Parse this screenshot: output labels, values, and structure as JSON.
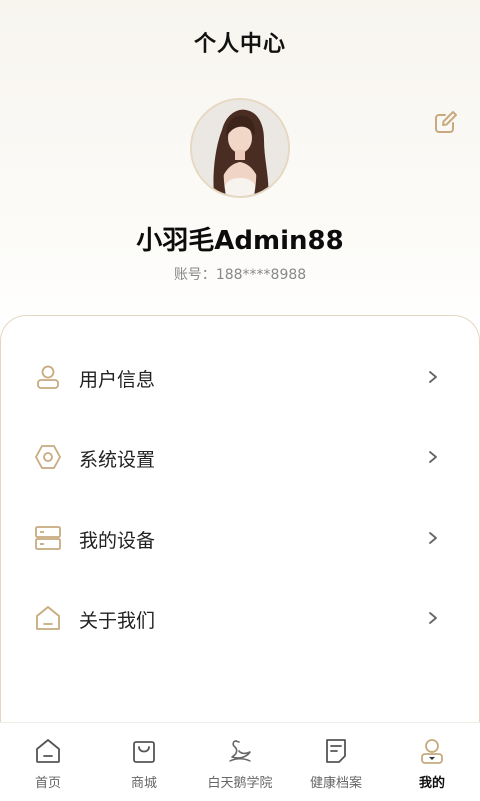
{
  "header": {
    "title": "个人中心"
  },
  "profile": {
    "username": "小羽毛Admin88",
    "account_label": "账号：",
    "account_value": "188****8988"
  },
  "menu": [
    {
      "label": "用户信息",
      "icon": "user-icon"
    },
    {
      "label": "系统设置",
      "icon": "settings-hexagon-icon"
    },
    {
      "label": "我的设备",
      "icon": "device-icon"
    },
    {
      "label": "关于我们",
      "icon": "house-icon"
    }
  ],
  "tabs": [
    {
      "label": "首页",
      "icon": "home-icon"
    },
    {
      "label": "商城",
      "icon": "shopping-bag-icon"
    },
    {
      "label": "白天鹅学院",
      "icon": "swan-icon"
    },
    {
      "label": "健康档案",
      "icon": "document-icon"
    },
    {
      "label": "我的",
      "icon": "person-icon",
      "active": true
    }
  ],
  "colors": {
    "accent_gold": "#c8aa7e",
    "icon_gray": "#555555",
    "text_primary": "#111111"
  }
}
